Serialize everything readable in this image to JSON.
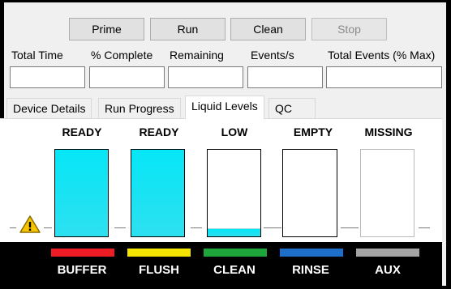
{
  "toolbar": {
    "prime_label": "Prime",
    "run_label": "Run",
    "clean_label": "Clean",
    "stop_label": "Stop"
  },
  "stats": {
    "labels": [
      "Total Time",
      "% Complete",
      "Remaining",
      "Events/s",
      "Total Events (% Max)"
    ],
    "values": [
      "",
      "",
      "",
      "",
      ""
    ]
  },
  "tabs": [
    {
      "label": "Device Details",
      "active": false
    },
    {
      "label": "Run Progress",
      "active": false
    },
    {
      "label": "Liquid Levels",
      "active": true
    },
    {
      "label": "QC",
      "active": false
    }
  ],
  "warning_icon": "warning-triangle-icon",
  "tanks": [
    {
      "status": "READY",
      "label": "BUFFER",
      "color": "#ee1c25",
      "level": 1.0
    },
    {
      "status": "READY",
      "label": "FLUSH",
      "color": "#f5e600",
      "level": 1.0
    },
    {
      "status": "LOW",
      "label": "CLEAN",
      "color": "#1fa63a",
      "level": 0.08
    },
    {
      "status": "EMPTY",
      "label": "RINSE",
      "color": "#1d6fc9",
      "level": 0.0
    },
    {
      "status": "MISSING",
      "label": "AUX",
      "color": "#a4a4a4",
      "level": 0.0
    }
  ],
  "fill_color": "#00e5f5"
}
